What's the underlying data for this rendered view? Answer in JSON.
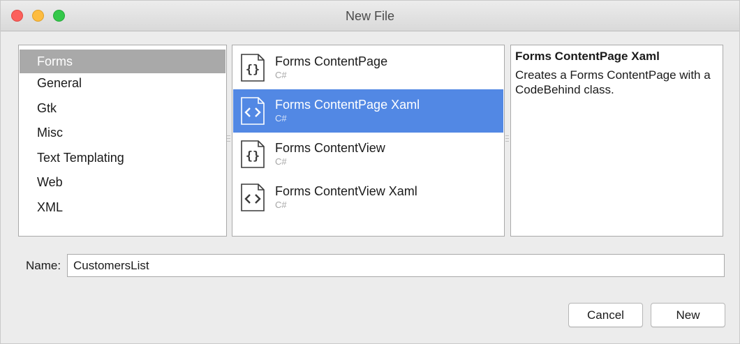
{
  "window": {
    "title": "New File"
  },
  "categories": [
    {
      "label": "Forms",
      "selected": true
    },
    {
      "label": "General",
      "selected": false
    },
    {
      "label": "Gtk",
      "selected": false
    },
    {
      "label": "Misc",
      "selected": false
    },
    {
      "label": "Text Templating",
      "selected": false
    },
    {
      "label": "Web",
      "selected": false
    },
    {
      "label": "XML",
      "selected": false
    }
  ],
  "templates": [
    {
      "name": "Forms ContentPage",
      "language": "C#",
      "icon": "code-braces-icon",
      "selected": false
    },
    {
      "name": "Forms ContentPage Xaml",
      "language": "C#",
      "icon": "xml-brackets-icon",
      "selected": true
    },
    {
      "name": "Forms ContentView",
      "language": "C#",
      "icon": "code-braces-icon",
      "selected": false
    },
    {
      "name": "Forms ContentView Xaml",
      "language": "C#",
      "icon": "xml-brackets-icon",
      "selected": false
    }
  ],
  "description": {
    "title": "Forms ContentPage Xaml",
    "text": "Creates a Forms ContentPage with a CodeBehind class."
  },
  "name_field": {
    "label": "Name:",
    "value": "CustomersList"
  },
  "buttons": {
    "cancel": "Cancel",
    "new": "New"
  },
  "colors": {
    "selection_blue": "#5288e4",
    "category_selected": "#a9a9a9",
    "close": "#fc605c",
    "minimize": "#fdbc40",
    "maximize": "#34c84a"
  }
}
